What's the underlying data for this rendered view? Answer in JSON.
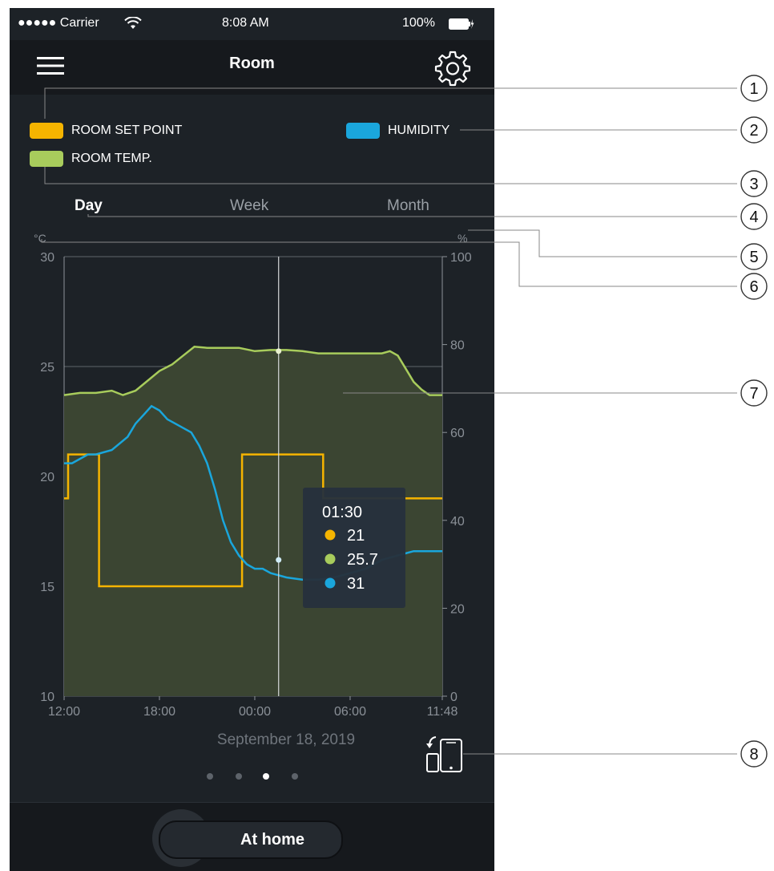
{
  "status_bar": {
    "carrier": "●●●●● Carrier",
    "time": "8:08 AM",
    "battery": "100%"
  },
  "nav": {
    "title": "Room"
  },
  "legend": {
    "set_point": "ROOM SET POINT",
    "humidity": "HUMIDITY",
    "room_temp": "ROOM TEMP."
  },
  "tabs": [
    {
      "label": "Day",
      "active": true
    },
    {
      "label": "Week",
      "active": false
    },
    {
      "label": "Month",
      "active": false
    }
  ],
  "colors": {
    "set_point": "#f5b400",
    "humidity": "#1aa6dc",
    "room_temp": "#a8cc5c",
    "area_fill": "#3b4532",
    "background": "#1d2227"
  },
  "chart_data": {
    "type": "line",
    "left_axis": {
      "unit": "°C",
      "ylim": [
        10,
        30
      ],
      "ticks": [
        "10",
        "15",
        "20",
        "25",
        "30"
      ]
    },
    "right_axis": {
      "unit": "%",
      "ylim": [
        0,
        100
      ],
      "ticks": [
        "0",
        "20",
        "40",
        "60",
        "80",
        "100"
      ]
    },
    "x_range_hours": [
      0,
      23.8
    ],
    "x_ticks": [
      {
        "hour": 0,
        "label": "12:00"
      },
      {
        "hour": 6,
        "label": "18:00"
      },
      {
        "hour": 12,
        "label": "00:00"
      },
      {
        "hour": 18,
        "label": "06:00"
      },
      {
        "hour": 23.8,
        "label": "11:48"
      }
    ],
    "grid": true,
    "series": [
      {
        "name": "ROOM TEMP.",
        "axis": "left",
        "style": "area",
        "x": [
          0,
          1,
          2,
          3,
          3.7,
          4.5,
          5,
          6,
          6.8,
          7.5,
          8.2,
          9,
          10,
          11,
          12,
          13,
          14,
          15,
          16,
          17,
          18,
          19,
          20,
          20.5,
          21,
          21.5,
          22,
          22.5,
          23,
          23.8
        ],
        "y": [
          23.7,
          23.8,
          23.8,
          23.9,
          23.7,
          23.9,
          24.2,
          24.8,
          25.1,
          25.5,
          25.9,
          25.85,
          25.85,
          25.85,
          25.7,
          25.75,
          25.75,
          25.7,
          25.6,
          25.6,
          25.6,
          25.6,
          25.6,
          25.7,
          25.5,
          24.9,
          24.3,
          23.95,
          23.7,
          23.7
        ]
      },
      {
        "name": "HUMIDITY",
        "axis": "right",
        "style": "line",
        "x": [
          0,
          0.5,
          1,
          1.5,
          2,
          3,
          4,
          4.5,
          5,
          5.5,
          6,
          6.5,
          7,
          8,
          8.5,
          9,
          9.5,
          10,
          10.5,
          11,
          11.5,
          12,
          12.5,
          13,
          14,
          15,
          16,
          17,
          18,
          19,
          20,
          21,
          22,
          23,
          23.8
        ],
        "y": [
          53,
          53,
          54,
          55,
          55,
          56,
          59,
          62,
          64,
          66,
          65,
          63,
          62,
          60,
          57,
          53,
          47,
          40,
          35,
          32,
          30,
          29,
          29,
          28,
          27,
          26.5,
          26.5,
          27,
          28,
          29,
          31,
          32,
          33,
          33,
          33
        ]
      },
      {
        "name": "ROOM SET POINT",
        "axis": "left",
        "style": "step",
        "x": [
          0,
          0.25,
          0.25,
          2.2,
          2.2,
          11.2,
          11.2,
          16.3,
          16.3,
          23.8
        ],
        "y": [
          19,
          19,
          21,
          21,
          15,
          15,
          21,
          21,
          19,
          19
        ]
      }
    ],
    "cursor": {
      "hour": 13.5,
      "label": "01:30",
      "values": [
        "21",
        "25.7",
        "31"
      ]
    }
  },
  "date_label": "September 18, 2019",
  "pager": {
    "count": 4,
    "active_index": 2
  },
  "mode": {
    "label": "At home"
  },
  "callouts": [
    "1",
    "2",
    "3",
    "4",
    "5",
    "6",
    "7",
    "8"
  ]
}
